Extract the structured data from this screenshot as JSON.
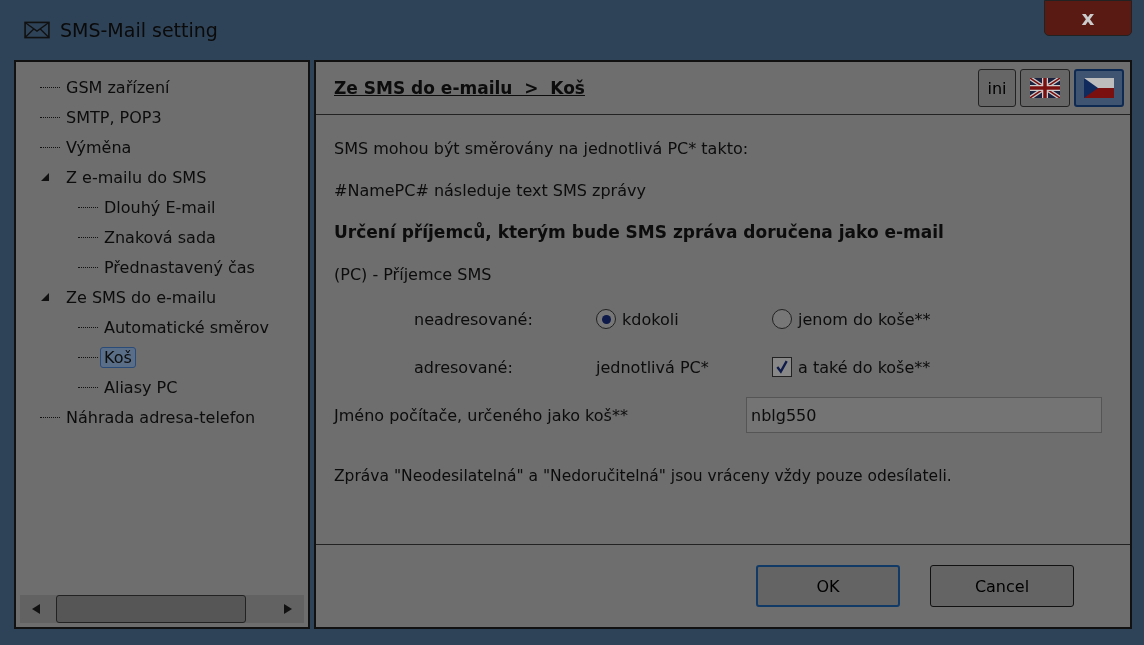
{
  "window": {
    "title": "SMS-Mail setting",
    "close": "x"
  },
  "tree": [
    {
      "label": "GSM zařízení",
      "selected": false
    },
    {
      "label": "SMTP, POP3",
      "selected": false
    },
    {
      "label": "Výměna",
      "selected": false
    },
    {
      "label": "Z e-mailu do SMS",
      "selected": false,
      "expanded": true,
      "children": [
        {
          "label": "Dlouhý E-mail",
          "selected": false
        },
        {
          "label": "Znaková sada",
          "selected": false
        },
        {
          "label": "Přednastavený čas",
          "selected": false
        }
      ]
    },
    {
      "label": "Ze SMS do e-mailu",
      "selected": false,
      "expanded": true,
      "children": [
        {
          "label": "Automatické směrov",
          "selected": false
        },
        {
          "label": "Koš",
          "selected": true
        },
        {
          "label": "Aliasy PC",
          "selected": false
        }
      ]
    },
    {
      "label": "Náhrada adresa-telefon",
      "selected": false
    }
  ],
  "header": {
    "breadcrumb": "Ze SMS do e-mailu  >  Koš",
    "ini_button": "ini",
    "languages": [
      {
        "kind": "uk",
        "selected": false
      },
      {
        "kind": "cz",
        "selected": true
      }
    ]
  },
  "content": {
    "intro": "SMS mohou být směrovány na jednotlivá PC* takto:",
    "format": "#NamePC# následuje text SMS zprávy",
    "heading": "Určení příjemců, kterým bude SMS zpráva doručena jako e-mail",
    "recipient_label": "(PC) - Příjemce SMS",
    "unaddressed": {
      "label": "neadresované:",
      "options": [
        {
          "label": "kdokoli",
          "selected": true
        },
        {
          "label": "jenom do koše**",
          "selected": false
        }
      ]
    },
    "addressed": {
      "label": "adresované:",
      "value": "jednotlivá PC*",
      "checkbox": {
        "label": "a také do koše**",
        "checked": true
      }
    },
    "computer_name": {
      "label": "Jméno počítače, určeného jako koš**",
      "value": "nblg550"
    },
    "note": "Zpráva \"Neodesilatelná\" a \"Nedoručitelná\" jsou vráceny vždy pouze odesílateli."
  },
  "buttons": [
    {
      "label": "OK",
      "kind": "default"
    },
    {
      "label": "Cancel",
      "kind": "normal"
    }
  ]
}
